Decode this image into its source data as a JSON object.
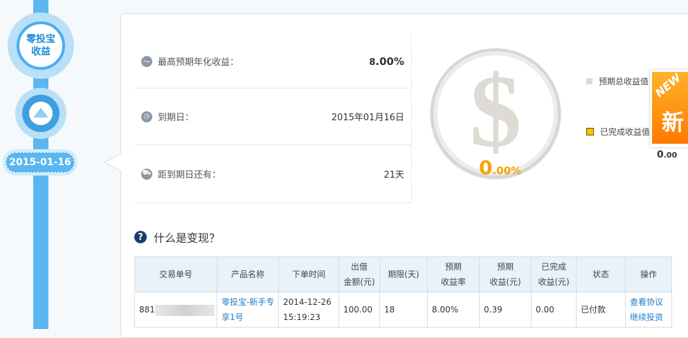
{
  "timeline": {
    "node_label_line1": "零投宝",
    "node_label_line2": "收益",
    "date": "2015-01-16"
  },
  "info": {
    "max_rate_label": "最高预期年化收益：",
    "max_rate_int": "8",
    "max_rate_dec": ".00%",
    "due_label": "到期日：",
    "due_value": "2015年01月16日",
    "remaining_label": "距到期日还有：",
    "remaining_value": "21天"
  },
  "circle": {
    "symbol": "$",
    "pct_int": "0",
    "pct_dec": ".00%"
  },
  "legend": {
    "expected": "预期总收益值",
    "completed": "已完成收益值"
  },
  "badge": {
    "new": "NEW",
    "xin": "新",
    "value_int": "0",
    "value_dec": ".00"
  },
  "help": {
    "icon": "?",
    "text": "什么是变现？"
  },
  "table": {
    "headers": [
      "交易单号",
      "产品名称",
      "下单时间",
      "出借\n金额(元)",
      "期限(天)",
      "预期\n收益率",
      "预期\n收益(元)",
      "已完成\n收益(元)",
      "状态",
      "操作"
    ],
    "row": {
      "order_prefix": "881",
      "product": "零投宝-新手专享1号",
      "date": "2014-12-26",
      "time": "15:19:23",
      "amount": "100.00",
      "term": "18",
      "rate": "8.00%",
      "expected": "0.39",
      "completed": "0.00",
      "status": "已付款",
      "action1": "查看协议",
      "action2": "继续投资"
    }
  },
  "colors": {
    "timeline": "#5bb6f0",
    "accent_orange": "#f5a300",
    "link": "#1f7cc8"
  }
}
